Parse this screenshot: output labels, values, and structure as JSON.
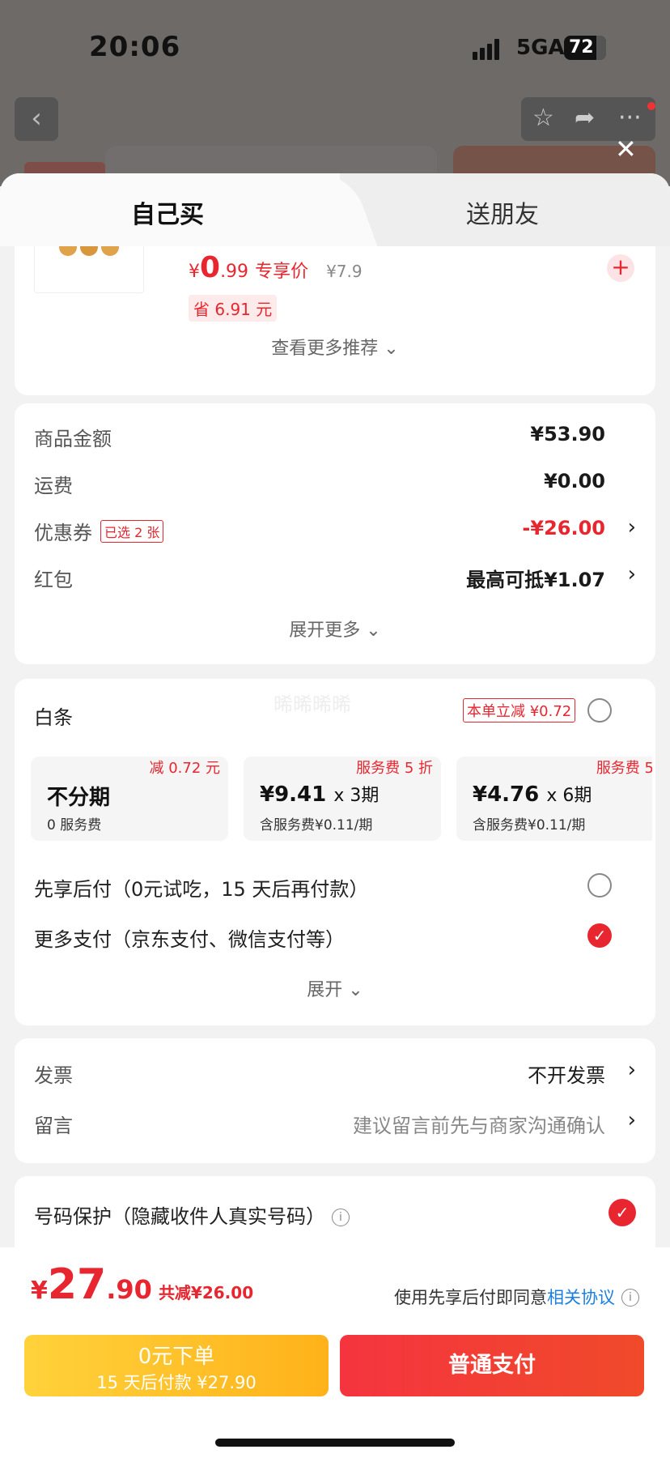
{
  "status_bar": {
    "time": "20:06",
    "network": "5GA",
    "battery": "72"
  },
  "top_nav": {
    "back_icon": "chevron-left-icon",
    "actions": [
      "star-icon",
      "share-icon",
      "more-icon"
    ],
    "close_icon": "close-icon"
  },
  "tabs": [
    {
      "label": "自己买",
      "active": true
    },
    {
      "label": "送朋友",
      "active": false
    }
  ],
  "recommend": {
    "yen": "¥",
    "price_int": "0",
    "price_dec": ".99",
    "price_label": "专享价",
    "original_price": "¥7.9",
    "save_text": "省 6.91 元",
    "add_icon": "plus-icon",
    "more_link": "查看更多推荐"
  },
  "summary": {
    "rows": [
      {
        "label": "商品金额",
        "value": "¥53.90"
      },
      {
        "label": "运费",
        "value": "¥0.00"
      },
      {
        "label": "优惠券",
        "tag": "已选 2 张",
        "value": "-¥26.00"
      },
      {
        "label": "红包",
        "value": "最高可抵¥1.07"
      }
    ],
    "expand": "展开更多"
  },
  "payment": {
    "baitiao_label": "白条",
    "baitiao_badge": "本单立减 ¥0.72",
    "plans": [
      {
        "tag": "减 0.72 元",
        "title": "不分期",
        "mult": "",
        "sub": "0 服务费"
      },
      {
        "tag": "服务费 5 折",
        "title": "¥9.41",
        "mult": "x 3期",
        "sub": "含服务费¥0.11/期"
      },
      {
        "tag": "服务费 5",
        "title": "¥4.76",
        "mult": "x 6期",
        "sub": "含服务费¥0.11/期"
      }
    ],
    "pay_later": "先享后付（0元试吃，15 天后再付款）",
    "more_pay": "更多支付（京东支付、微信支付等）",
    "expand": "展开"
  },
  "extra": {
    "invoice_label": "发票",
    "invoice_value": "不开发票",
    "note_label": "留言",
    "note_value": "建议留言前先与商家沟通确认"
  },
  "privacy": {
    "label": "号码保护（隐藏收件人真实号码）"
  },
  "bottom_bar": {
    "yen": "¥",
    "total_int": "27",
    "total_dec": ".90",
    "total_cut": "共减¥26.00",
    "agree_text": "使用先享后付即同意",
    "agree_link": "相关协议",
    "btn_later_1": "0元下单",
    "btn_later_2": "15 天后付款 ¥27.90",
    "btn_pay": "普通支付"
  },
  "colors": {
    "accent": "#e8262f",
    "yellow": "#ffc22a",
    "link": "#1a7fe0"
  }
}
